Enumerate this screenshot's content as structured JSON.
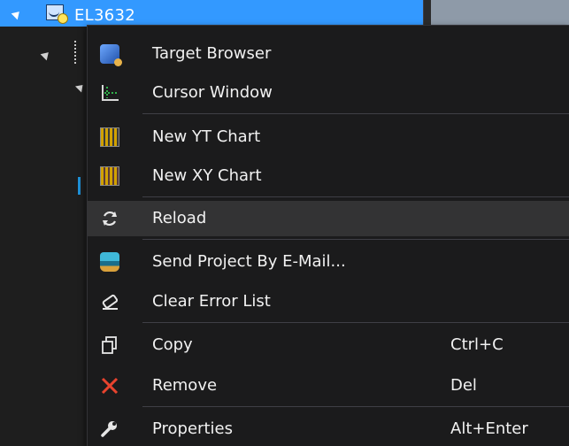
{
  "tree": {
    "root_label": "EL3632"
  },
  "context_menu": {
    "items": [
      {
        "label": "Target Browser",
        "icon": "target-browser-icon",
        "shortcut": ""
      },
      {
        "label": "Cursor Window",
        "icon": "cursor-window-icon",
        "shortcut": ""
      },
      {
        "label": "New YT Chart",
        "icon": "yt-chart-icon",
        "shortcut": ""
      },
      {
        "label": "New XY Chart",
        "icon": "xy-chart-icon",
        "shortcut": ""
      },
      {
        "label": "Reload",
        "icon": "reload-icon",
        "shortcut": ""
      },
      {
        "label": "Send Project By E-Mail...",
        "icon": "email-icon",
        "shortcut": ""
      },
      {
        "label": "Clear Error List",
        "icon": "eraser-icon",
        "shortcut": ""
      },
      {
        "label": "Copy",
        "icon": "copy-icon",
        "shortcut": "Ctrl+C"
      },
      {
        "label": "Remove",
        "icon": "remove-icon",
        "shortcut": "Del"
      },
      {
        "label": "Properties",
        "icon": "wrench-icon",
        "shortcut": "Alt+Enter"
      }
    ],
    "hovered_item": "Reload"
  },
  "colors": {
    "selection_blue": "#3399ff",
    "menu_background": "#1b1b1c",
    "menu_hover": "#333334",
    "remove_red": "#e8432e"
  }
}
